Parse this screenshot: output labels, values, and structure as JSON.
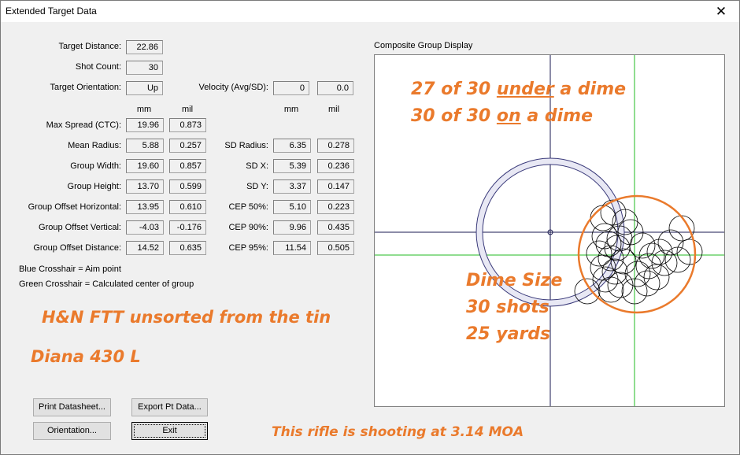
{
  "window": {
    "title": "Extended Target Data",
    "close_glyph": "✕"
  },
  "fields": {
    "target_distance": {
      "label": "Target Distance:",
      "value": "22.86"
    },
    "shot_count": {
      "label": "Shot Count:",
      "value": "30"
    },
    "target_orientation": {
      "label": "Target Orientation:",
      "value": "Up"
    },
    "velocity": {
      "label": "Velocity (Avg/SD):",
      "avg": "0",
      "sd": "0.0"
    }
  },
  "columns": {
    "mm": "mm",
    "mil": "mil"
  },
  "left_stats": [
    {
      "label": "Max Spread (CTC):",
      "mm": "19.96",
      "mil": "0.873"
    },
    {
      "label": "Mean Radius:",
      "mm": "5.88",
      "mil": "0.257"
    },
    {
      "label": "Group Width:",
      "mm": "19.60",
      "mil": "0.857"
    },
    {
      "label": "Group Height:",
      "mm": "13.70",
      "mil": "0.599"
    },
    {
      "label": "Group Offset Horizontal:",
      "mm": "13.95",
      "mil": "0.610"
    },
    {
      "label": "Group Offset Vertical:",
      "mm": "-4.03",
      "mil": "-0.176"
    },
    {
      "label": "Group Offset Distance:",
      "mm": "14.52",
      "mil": "0.635"
    }
  ],
  "right_stats": [
    {
      "label": "SD Radius:",
      "mm": "6.35",
      "mil": "0.278"
    },
    {
      "label": "SD X:",
      "mm": "5.39",
      "mil": "0.236"
    },
    {
      "label": "SD Y:",
      "mm": "3.37",
      "mil": "0.147"
    },
    {
      "label": "CEP 50%:",
      "mm": "5.10",
      "mil": "0.223"
    },
    {
      "label": "CEP 90%:",
      "mm": "9.96",
      "mil": "0.435"
    },
    {
      "label": "CEP 95%:",
      "mm": "11.54",
      "mil": "0.505"
    }
  ],
  "legend": {
    "blue": "Blue Crosshair = Aim point",
    "green": "Green Crosshair = Calculated center of group"
  },
  "buttons": {
    "print": "Print Datasheet...",
    "export": "Export Pt Data...",
    "orientation": "Orientation...",
    "exit": "Exit"
  },
  "display": {
    "title": "Composite Group Display",
    "colors": {
      "aim": "#1a1a50",
      "center": "#22bb22",
      "dime": "#ea7a2c",
      "reference_ring": "#3a3a7a",
      "ring_fill": "#e8e8f4",
      "shot": "#000000"
    }
  },
  "annotations": {
    "line1_pre": "27 of 30 ",
    "line1_u": "under",
    "line1_post": " a dime",
    "line2_pre": "30 of 30 ",
    "line2_u": "on",
    "line2_post": " a dime",
    "dime1": "Dime Size",
    "dime2": "30 shots",
    "dime3": "25 yards",
    "pellet": "H&N FTT unsorted from the tin",
    "rifle": "Diana 430 L",
    "moa": "This rifle is shooting at 3.14 MOA"
  }
}
